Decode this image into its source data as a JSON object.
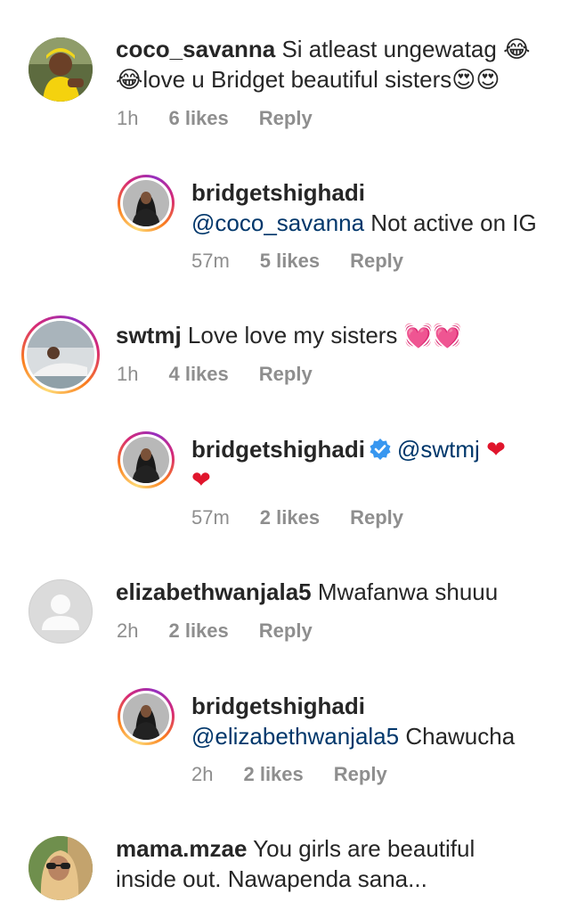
{
  "comments": [
    {
      "username": "coco_savanna",
      "text_a": "Si atleast ungewatag ",
      "emoji_a": "😂",
      "emoji_b": "😂",
      "text_b": "love u Bridget beautiful sisters",
      "emoji_c": "😍",
      "emoji_d": "😍",
      "time": "1h",
      "likes": "6 likes",
      "reply": "Reply"
    },
    {
      "username": "bridgetshighadi",
      "mention": "@coco_savanna",
      "text": " Not active on IG",
      "time": "57m",
      "likes": "5 likes",
      "reply": "Reply"
    },
    {
      "username": "swtmj",
      "text": " Love love my sisters ",
      "emoji_a": "💓",
      "emoji_b": "💓",
      "time": "1h",
      "likes": "4 likes",
      "reply": "Reply"
    },
    {
      "username": "bridgetshighadi",
      "mention": "@swtmj",
      "emoji_a": "❤",
      "emoji_b": "❤",
      "time": "57m",
      "likes": "2 likes",
      "reply": "Reply"
    },
    {
      "username": "elizabethwanjala5",
      "text": " Mwafanwa shuuu",
      "time": "2h",
      "likes": "2 likes",
      "reply": "Reply"
    },
    {
      "username": "bridgetshighadi",
      "mention": "@elizabethwanjala5",
      "text": " Chawucha",
      "time": "2h",
      "likes": "2 likes",
      "reply": "Reply"
    },
    {
      "username": "mama.mzae",
      "text_a": " You girls are beautiful",
      "text_b": "inside out. Nawapenda sana..."
    }
  ],
  "colors": {
    "text": "#262626",
    "meta": "#8e8e8e",
    "mention": "#00376b",
    "verified": "#3897f0",
    "heart": "#e0152c"
  }
}
